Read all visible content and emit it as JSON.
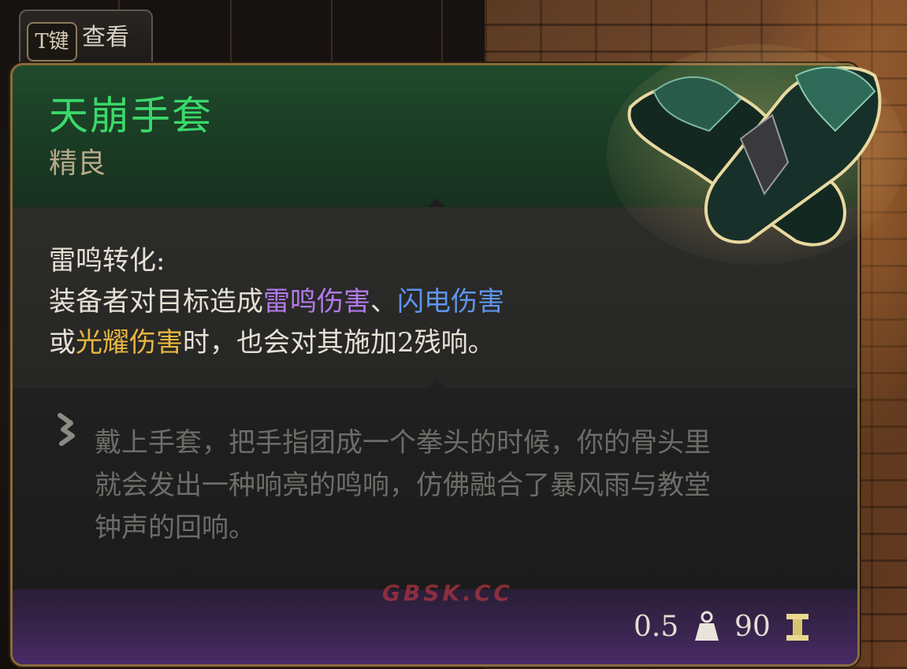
{
  "hint": {
    "key": "T键",
    "label": "查看"
  },
  "item": {
    "name": "天崩手套",
    "rarity": "精良",
    "name_color": "#3bd96a"
  },
  "effect": {
    "title": "雷鸣转化:",
    "line1_prefix": "装备者对目标造成",
    "kw_thunder": "雷鸣伤害",
    "sep": "、",
    "kw_lightning": "闪电伤害",
    "line2_prefix": "或",
    "kw_radiant": "光耀伤害",
    "line2_suffix": "时，也会对其施加2残响。"
  },
  "lore": {
    "lines": [
      "戴上手套，把手指团成一个拳头的时候，你的骨头里",
      "就会发出一种响亮的鸣响，仿佛融合了暴风雨与教堂",
      "钟声的回响。"
    ]
  },
  "footer": {
    "weight": "0.5",
    "price": "90"
  },
  "colors": {
    "thunder": "#b27ae8",
    "lightning": "#5f95ee",
    "radiant": "#e8b640",
    "frame": "#8a6a3c"
  },
  "icons": [
    "scroll-icon",
    "weight-icon",
    "gold-coin-icon",
    "gloves-item-icon"
  ]
}
